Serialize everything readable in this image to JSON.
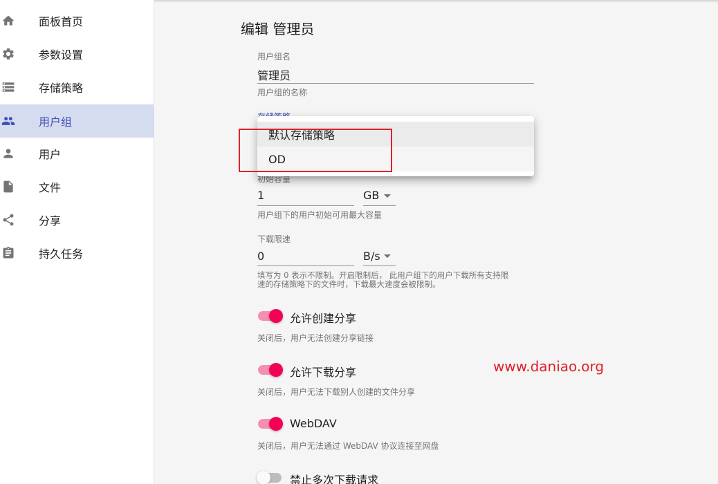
{
  "sidebar": {
    "items": [
      {
        "label": "面板首页",
        "icon": "home-icon"
      },
      {
        "label": "参数设置",
        "icon": "gear-icon"
      },
      {
        "label": "存储策略",
        "icon": "storage-list-icon"
      },
      {
        "label": "用户组",
        "icon": "people-icon",
        "active": true
      },
      {
        "label": "用户",
        "icon": "person-icon"
      },
      {
        "label": "文件",
        "icon": "file-icon"
      },
      {
        "label": "分享",
        "icon": "share-icon"
      },
      {
        "label": "持久任务",
        "icon": "clipboard-icon"
      }
    ],
    "active_color": "#3f51b5",
    "active_bg": "#d6dcf0"
  },
  "form": {
    "title": "编辑 管理员",
    "group_name": {
      "label": "用户组名",
      "value": "管理员",
      "helper": "用户组的名称"
    },
    "storage_policy": {
      "label": "存储策略",
      "options": [
        "默认存储策略",
        "OD"
      ],
      "selected": "默认存储策略"
    },
    "initial_capacity": {
      "label": "初始容量",
      "value": "1",
      "unit": "GB",
      "helper": "用户组下的用户初始可用最大容量"
    },
    "download_limit": {
      "label": "下载限速",
      "value": "0",
      "unit": "B/s",
      "helper_line1": "填写为 0 表示不限制。开启限制后， 此用户组下的用户下载所有支持限",
      "helper_line2": "速的存储策略下的文件时，下载最大速度会被限制。"
    },
    "switches": [
      {
        "label": "允许创建分享",
        "on": true,
        "helper": "关闭后，用户无法创建分享链接"
      },
      {
        "label": "允许下载分享",
        "on": true,
        "helper": "关闭后，用户无法下载别人创建的文件分享"
      },
      {
        "label": "WebDAV",
        "on": true,
        "helper": "关闭后，用户无法通过 WebDAV 协议连接至网盘"
      },
      {
        "label": "禁止多次下载请求",
        "on": false
      }
    ],
    "switch_on_color": "#f50057"
  },
  "watermark": "www.daniao.org",
  "annotation_color": "#e0202a"
}
